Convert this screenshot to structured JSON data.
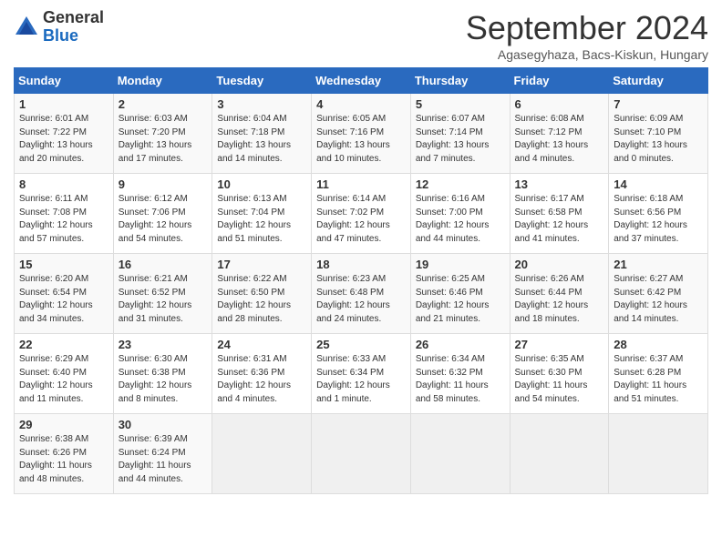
{
  "header": {
    "logo_general": "General",
    "logo_blue": "Blue",
    "month_title": "September 2024",
    "location": "Agasegyhaza, Bacs-Kiskun, Hungary"
  },
  "weekdays": [
    "Sunday",
    "Monday",
    "Tuesday",
    "Wednesday",
    "Thursday",
    "Friday",
    "Saturday"
  ],
  "weeks": [
    [
      {
        "day": "1",
        "sunrise": "Sunrise: 6:01 AM",
        "sunset": "Sunset: 7:22 PM",
        "daylight": "Daylight: 13 hours and 20 minutes."
      },
      {
        "day": "2",
        "sunrise": "Sunrise: 6:03 AM",
        "sunset": "Sunset: 7:20 PM",
        "daylight": "Daylight: 13 hours and 17 minutes."
      },
      {
        "day": "3",
        "sunrise": "Sunrise: 6:04 AM",
        "sunset": "Sunset: 7:18 PM",
        "daylight": "Daylight: 13 hours and 14 minutes."
      },
      {
        "day": "4",
        "sunrise": "Sunrise: 6:05 AM",
        "sunset": "Sunset: 7:16 PM",
        "daylight": "Daylight: 13 hours and 10 minutes."
      },
      {
        "day": "5",
        "sunrise": "Sunrise: 6:07 AM",
        "sunset": "Sunset: 7:14 PM",
        "daylight": "Daylight: 13 hours and 7 minutes."
      },
      {
        "day": "6",
        "sunrise": "Sunrise: 6:08 AM",
        "sunset": "Sunset: 7:12 PM",
        "daylight": "Daylight: 13 hours and 4 minutes."
      },
      {
        "day": "7",
        "sunrise": "Sunrise: 6:09 AM",
        "sunset": "Sunset: 7:10 PM",
        "daylight": "Daylight: 13 hours and 0 minutes."
      }
    ],
    [
      {
        "day": "8",
        "sunrise": "Sunrise: 6:11 AM",
        "sunset": "Sunset: 7:08 PM",
        "daylight": "Daylight: 12 hours and 57 minutes."
      },
      {
        "day": "9",
        "sunrise": "Sunrise: 6:12 AM",
        "sunset": "Sunset: 7:06 PM",
        "daylight": "Daylight: 12 hours and 54 minutes."
      },
      {
        "day": "10",
        "sunrise": "Sunrise: 6:13 AM",
        "sunset": "Sunset: 7:04 PM",
        "daylight": "Daylight: 12 hours and 51 minutes."
      },
      {
        "day": "11",
        "sunrise": "Sunrise: 6:14 AM",
        "sunset": "Sunset: 7:02 PM",
        "daylight": "Daylight: 12 hours and 47 minutes."
      },
      {
        "day": "12",
        "sunrise": "Sunrise: 6:16 AM",
        "sunset": "Sunset: 7:00 PM",
        "daylight": "Daylight: 12 hours and 44 minutes."
      },
      {
        "day": "13",
        "sunrise": "Sunrise: 6:17 AM",
        "sunset": "Sunset: 6:58 PM",
        "daylight": "Daylight: 12 hours and 41 minutes."
      },
      {
        "day": "14",
        "sunrise": "Sunrise: 6:18 AM",
        "sunset": "Sunset: 6:56 PM",
        "daylight": "Daylight: 12 hours and 37 minutes."
      }
    ],
    [
      {
        "day": "15",
        "sunrise": "Sunrise: 6:20 AM",
        "sunset": "Sunset: 6:54 PM",
        "daylight": "Daylight: 12 hours and 34 minutes."
      },
      {
        "day": "16",
        "sunrise": "Sunrise: 6:21 AM",
        "sunset": "Sunset: 6:52 PM",
        "daylight": "Daylight: 12 hours and 31 minutes."
      },
      {
        "day": "17",
        "sunrise": "Sunrise: 6:22 AM",
        "sunset": "Sunset: 6:50 PM",
        "daylight": "Daylight: 12 hours and 28 minutes."
      },
      {
        "day": "18",
        "sunrise": "Sunrise: 6:23 AM",
        "sunset": "Sunset: 6:48 PM",
        "daylight": "Daylight: 12 hours and 24 minutes."
      },
      {
        "day": "19",
        "sunrise": "Sunrise: 6:25 AM",
        "sunset": "Sunset: 6:46 PM",
        "daylight": "Daylight: 12 hours and 21 minutes."
      },
      {
        "day": "20",
        "sunrise": "Sunrise: 6:26 AM",
        "sunset": "Sunset: 6:44 PM",
        "daylight": "Daylight: 12 hours and 18 minutes."
      },
      {
        "day": "21",
        "sunrise": "Sunrise: 6:27 AM",
        "sunset": "Sunset: 6:42 PM",
        "daylight": "Daylight: 12 hours and 14 minutes."
      }
    ],
    [
      {
        "day": "22",
        "sunrise": "Sunrise: 6:29 AM",
        "sunset": "Sunset: 6:40 PM",
        "daylight": "Daylight: 12 hours and 11 minutes."
      },
      {
        "day": "23",
        "sunrise": "Sunrise: 6:30 AM",
        "sunset": "Sunset: 6:38 PM",
        "daylight": "Daylight: 12 hours and 8 minutes."
      },
      {
        "day": "24",
        "sunrise": "Sunrise: 6:31 AM",
        "sunset": "Sunset: 6:36 PM",
        "daylight": "Daylight: 12 hours and 4 minutes."
      },
      {
        "day": "25",
        "sunrise": "Sunrise: 6:33 AM",
        "sunset": "Sunset: 6:34 PM",
        "daylight": "Daylight: 12 hours and 1 minute."
      },
      {
        "day": "26",
        "sunrise": "Sunrise: 6:34 AM",
        "sunset": "Sunset: 6:32 PM",
        "daylight": "Daylight: 11 hours and 58 minutes."
      },
      {
        "day": "27",
        "sunrise": "Sunrise: 6:35 AM",
        "sunset": "Sunset: 6:30 PM",
        "daylight": "Daylight: 11 hours and 54 minutes."
      },
      {
        "day": "28",
        "sunrise": "Sunrise: 6:37 AM",
        "sunset": "Sunset: 6:28 PM",
        "daylight": "Daylight: 11 hours and 51 minutes."
      }
    ],
    [
      {
        "day": "29",
        "sunrise": "Sunrise: 6:38 AM",
        "sunset": "Sunset: 6:26 PM",
        "daylight": "Daylight: 11 hours and 48 minutes."
      },
      {
        "day": "30",
        "sunrise": "Sunrise: 6:39 AM",
        "sunset": "Sunset: 6:24 PM",
        "daylight": "Daylight: 11 hours and 44 minutes."
      },
      null,
      null,
      null,
      null,
      null
    ]
  ]
}
